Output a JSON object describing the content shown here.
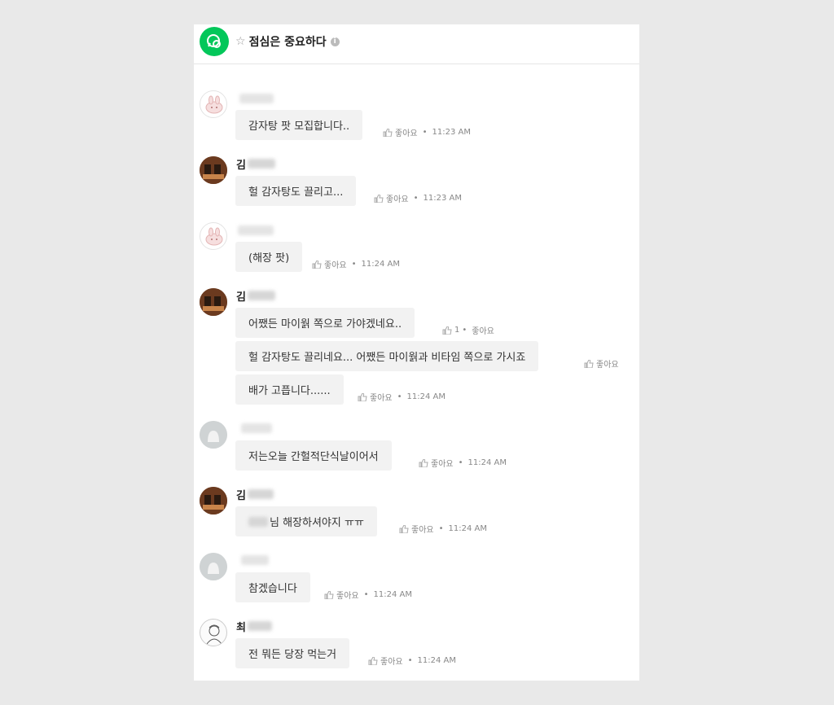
{
  "header": {
    "title": "점심은 중요하다",
    "star_icon": "☆",
    "info_icon": "i"
  },
  "accent_color": "#03c75a",
  "labels": {
    "like": "좋아요"
  },
  "messages": [
    {
      "sender": "",
      "text": "감자탕 팟 모집합니다..",
      "time": "11:23 AM"
    },
    {
      "sender": "김",
      "text": "헐 감자탕도 끌리고...",
      "time": "11:23 AM"
    },
    {
      "sender": "",
      "text": "(해장 팟)",
      "time": "11:24 AM"
    },
    {
      "sender": "김",
      "text": "어쨌든 마이웕 쪽으로 가야겠네요..",
      "likes": "1"
    },
    {
      "text": "헐 감자탕도 끌리네요... 어쨌든 마이웕과 비타임 쪽으로 가시죠"
    },
    {
      "text": "배가 고픕니다......",
      "time": "11:24 AM"
    },
    {
      "sender": "",
      "text": "저는오늘 간헐적단식날이어서",
      "time": "11:24 AM"
    },
    {
      "sender": "김",
      "text": "님 해장하셔야지 ㅠㅠ",
      "time": "11:24 AM"
    },
    {
      "sender": "",
      "text": "참겠습니다",
      "time": "11:24 AM"
    },
    {
      "sender": "최",
      "text": "전 뭐든 당장 먹는거",
      "time": "11:24 AM"
    }
  ]
}
